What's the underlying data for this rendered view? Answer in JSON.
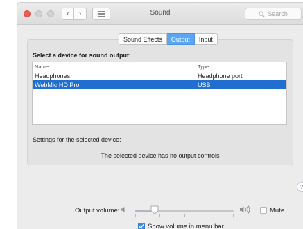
{
  "window": {
    "title": "Sound"
  },
  "toolbar": {
    "back_icon": "chevron-left-icon",
    "forward_icon": "chevron-right-icon",
    "show_all_icon": "grid-lines-icon",
    "search_placeholder": "Search"
  },
  "tabs": [
    {
      "label": "Sound Effects",
      "selected": false
    },
    {
      "label": "Output",
      "selected": true
    },
    {
      "label": "Input",
      "selected": false
    }
  ],
  "output": {
    "heading": "Select a device for sound output:",
    "columns": {
      "name": "Name",
      "type": "Type"
    },
    "devices": [
      {
        "name": "Headphones",
        "type": "Headphone port",
        "selected": false
      },
      {
        "name": "WebMic HD Pro",
        "type": "USB",
        "selected": true
      }
    ],
    "settings_label": "Settings for the selected device:",
    "no_controls_message": "The selected device has no output controls"
  },
  "help": {
    "label": "?"
  },
  "volume": {
    "label": "Output volume:",
    "level_fraction": 0.2,
    "mute_label": "Mute",
    "mute_checked": false
  },
  "menu_bar": {
    "show_volume_label": "Show volume in menu bar",
    "checked": true
  },
  "colors": {
    "accent": "#5aa6f4",
    "selection": "#1f6ed0",
    "close_button": "#ee5a55"
  }
}
